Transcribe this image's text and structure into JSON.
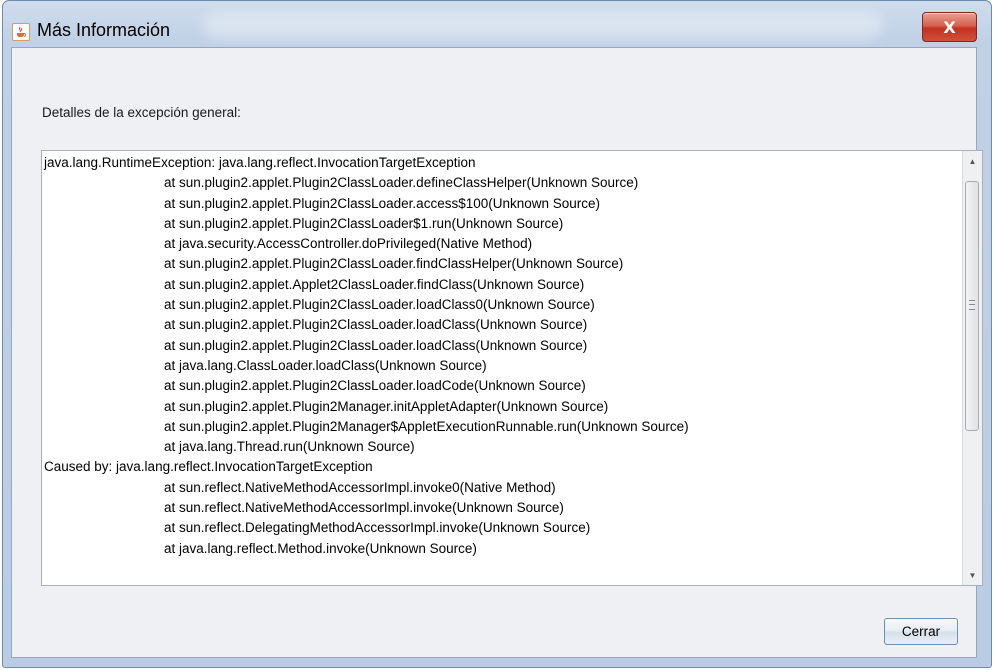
{
  "window": {
    "title": "Más Información",
    "close_label": "X"
  },
  "dialog": {
    "details_label": "Detalles de la excepción general:",
    "trace": [
      {
        "text": "java.lang.RuntimeException: java.lang.reflect.InvocationTargetException",
        "indent": false
      },
      {
        "text": "at sun.plugin2.applet.Plugin2ClassLoader.defineClassHelper(Unknown Source)",
        "indent": true
      },
      {
        "text": "at sun.plugin2.applet.Plugin2ClassLoader.access$100(Unknown Source)",
        "indent": true
      },
      {
        "text": "at sun.plugin2.applet.Plugin2ClassLoader$1.run(Unknown Source)",
        "indent": true
      },
      {
        "text": "at java.security.AccessController.doPrivileged(Native Method)",
        "indent": true
      },
      {
        "text": "at sun.plugin2.applet.Plugin2ClassLoader.findClassHelper(Unknown Source)",
        "indent": true
      },
      {
        "text": "at sun.plugin2.applet.Applet2ClassLoader.findClass(Unknown Source)",
        "indent": true
      },
      {
        "text": "at sun.plugin2.applet.Plugin2ClassLoader.loadClass0(Unknown Source)",
        "indent": true
      },
      {
        "text": "at sun.plugin2.applet.Plugin2ClassLoader.loadClass(Unknown Source)",
        "indent": true
      },
      {
        "text": "at sun.plugin2.applet.Plugin2ClassLoader.loadClass(Unknown Source)",
        "indent": true
      },
      {
        "text": "at java.lang.ClassLoader.loadClass(Unknown Source)",
        "indent": true
      },
      {
        "text": "at sun.plugin2.applet.Plugin2ClassLoader.loadCode(Unknown Source)",
        "indent": true
      },
      {
        "text": "at sun.plugin2.applet.Plugin2Manager.initAppletAdapter(Unknown Source)",
        "indent": true
      },
      {
        "text": "at sun.plugin2.applet.Plugin2Manager$AppletExecutionRunnable.run(Unknown Source)",
        "indent": true
      },
      {
        "text": "at java.lang.Thread.run(Unknown Source)",
        "indent": true
      },
      {
        "text": "Caused by: java.lang.reflect.InvocationTargetException",
        "indent": false
      },
      {
        "text": "at sun.reflect.NativeMethodAccessorImpl.invoke0(Native Method)",
        "indent": true
      },
      {
        "text": "at sun.reflect.NativeMethodAccessorImpl.invoke(Unknown Source)",
        "indent": true
      },
      {
        "text": "at sun.reflect.DelegatingMethodAccessorImpl.invoke(Unknown Source)",
        "indent": true
      },
      {
        "text": "at java.lang.reflect.Method.invoke(Unknown Source)",
        "indent": true
      }
    ],
    "close_button_label": "Cerrar"
  },
  "icons": {
    "app": "java-cup-icon",
    "close": "close-icon",
    "scroll_up": "arrow-up-icon",
    "scroll_down": "arrow-down-icon"
  },
  "colors": {
    "close_button": "#c2311f",
    "client_background": "#eef0f4",
    "frame": "#b9cce3"
  }
}
